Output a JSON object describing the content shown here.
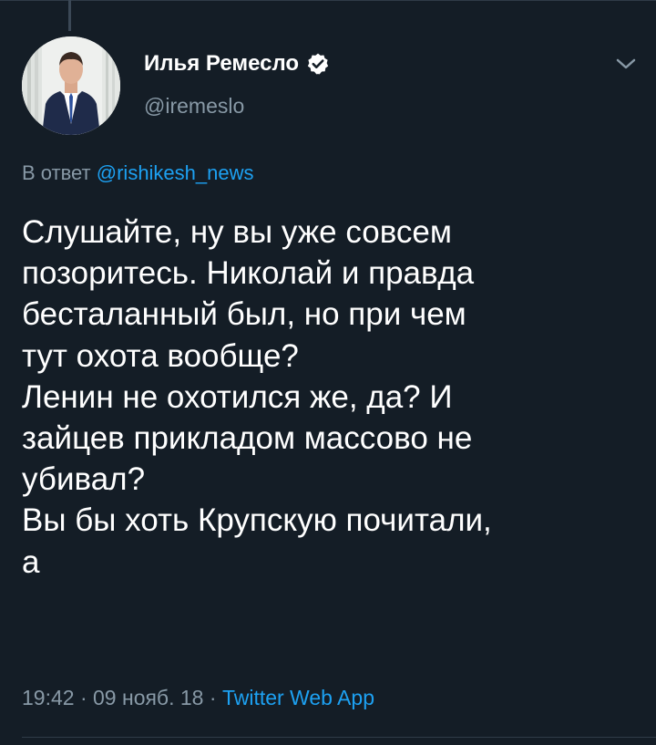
{
  "tweet": {
    "author": {
      "display_name": "Илья Ремесло",
      "handle": "@iremeslo",
      "verified": true,
      "avatar_icon": "user-avatar"
    },
    "reply": {
      "prefix": "В ответ",
      "mention": "@rishikesh_news"
    },
    "text": "Слушайте, ну вы уже совсем\nпозоритесь. Николай и правда\nбесталанный был, но при чем\nтут охота вообще?\nЛенин не охотился же, да? И\nзайцев прикладом массово не\nубивал?\nВы бы хоть Крупскую почитали,\nа",
    "meta": {
      "time": "19:42",
      "separator": " · ",
      "date": "09 нояб. 18",
      "source": "Twitter Web App"
    },
    "menu_icon": "chevron-down-icon"
  },
  "colors": {
    "background": "#141d26",
    "text_primary": "#ffffff",
    "text_secondary": "#8899a6",
    "link": "#1da1f2"
  }
}
